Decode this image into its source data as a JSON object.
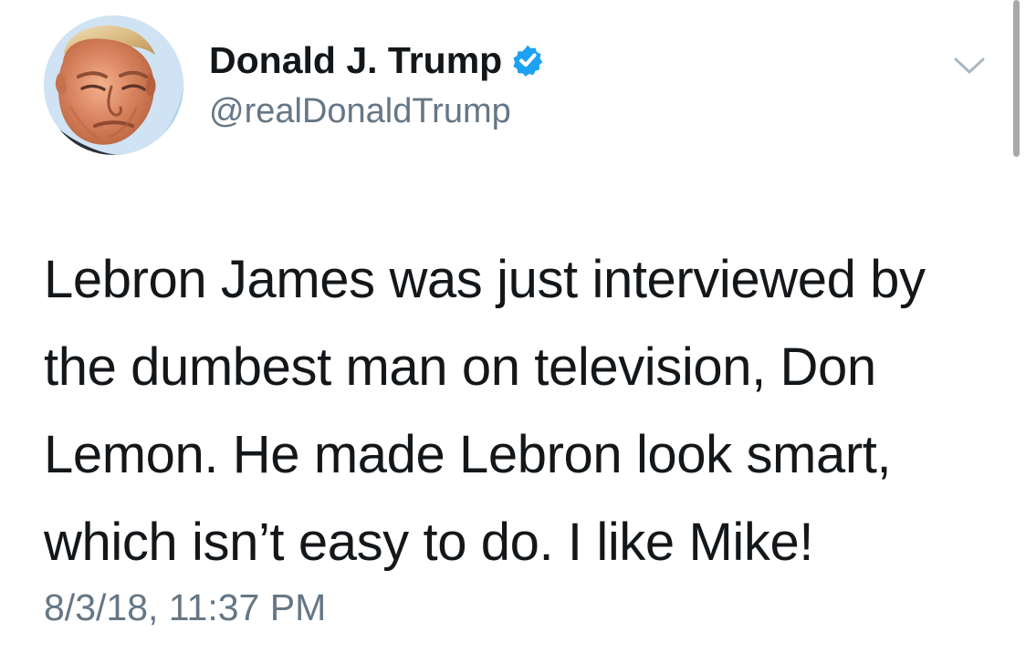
{
  "tweet": {
    "author": {
      "display_name": "Donald J. Trump",
      "handle": "@realDonaldTrump",
      "verified_icon": "verified-badge-icon",
      "avatar_description": "avatar"
    },
    "text_lines": [
      "Lebron James was just interviewed by",
      "the dumbest man on television, Don",
      "Lemon. He made Lebron look smart,",
      "which isn’t easy to do. I like Mike!"
    ],
    "timestamp": "8/3/18, 11:37 PM",
    "menu_icon": "chevron-down-icon"
  },
  "colors": {
    "text_primary": "#14171a",
    "text_secondary": "#657786",
    "verified_blue": "#1da1f2",
    "chevron": "#aab8c2",
    "scrollbar": "#a8a8a8"
  }
}
